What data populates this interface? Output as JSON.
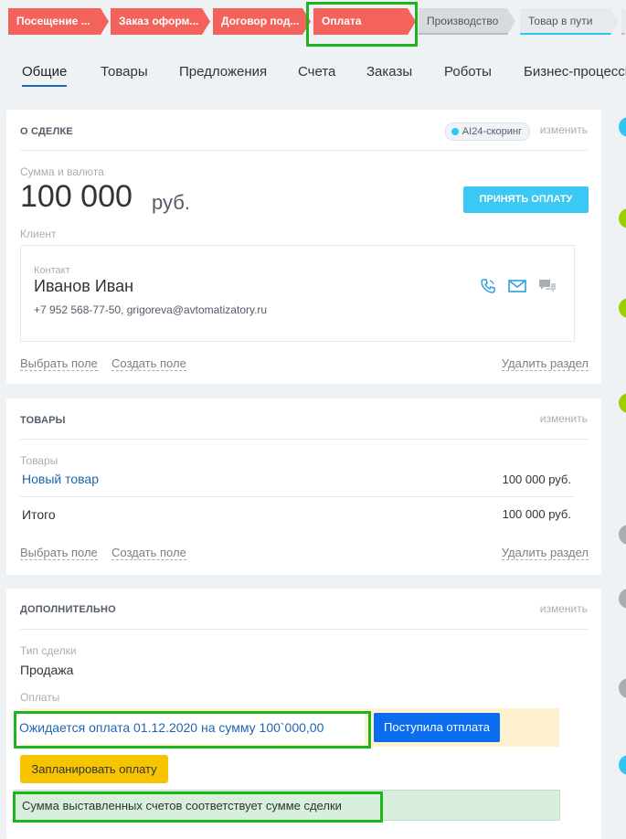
{
  "stages": [
    {
      "label": "Посещение ...",
      "state": "done"
    },
    {
      "label": "Заказ оформ...",
      "state": "done"
    },
    {
      "label": "Договор под...",
      "state": "done"
    },
    {
      "label": "Оплата",
      "state": "current"
    },
    {
      "label": "Производство",
      "state": "pending"
    },
    {
      "label": "Товар в пути",
      "state": "pending"
    }
  ],
  "tabs": [
    "Общие",
    "Товары",
    "Предложения",
    "Счета",
    "Заказы",
    "Роботы",
    "Бизнес-процессы"
  ],
  "active_tab": "Общие",
  "about": {
    "title": "О СДЕЛКЕ",
    "ai_badge": "AI24-скоринг",
    "change": "изменить",
    "amount_label": "Сумма и валюта",
    "amount": "100 000",
    "currency": "руб.",
    "accept_button": "ПРИНЯТЬ ОПЛАТУ",
    "client_label": "Клиент",
    "contact_label": "Контакт",
    "contact_name": "Иванов Иван",
    "contact_details": "+7 952 568-77-50, grigoreva@avtomatizatory.ru",
    "select_field": "Выбрать поле",
    "create_field": "Создать поле",
    "delete_section": "Удалить раздел"
  },
  "goods": {
    "title": "ТОВАРЫ",
    "change": "изменить",
    "goods_label": "Товары",
    "product_name": "Новый товар",
    "product_price": "100 000 руб.",
    "total_label": "Итого",
    "total_value": "100 000 руб.",
    "select_field": "Выбрать поле",
    "create_field": "Создать поле",
    "delete_section": "Удалить раздел"
  },
  "extra": {
    "title": "ДОПОЛНИТЕЛЬНО",
    "change": "изменить",
    "deal_type_label": "Тип сделки",
    "deal_type_value": "Продажа",
    "payments_label": "Оплаты",
    "payment_waiting": "Ожидается оплата 01.12.2020 на сумму 100`000,00",
    "payment_received_button": "Поступила отплата",
    "plan_payment_button": "Запланировать оплату",
    "sum_match_notice": "Сумма выставленных счетов соответствует сумме сделки"
  },
  "colors": {
    "stage_done": "#f3625b",
    "accent": "#3bc8f5",
    "link": "#2067b0",
    "highlight": "#1cb51c",
    "primary_button": "#0b6cf0",
    "warning_button": "#f7c500"
  }
}
